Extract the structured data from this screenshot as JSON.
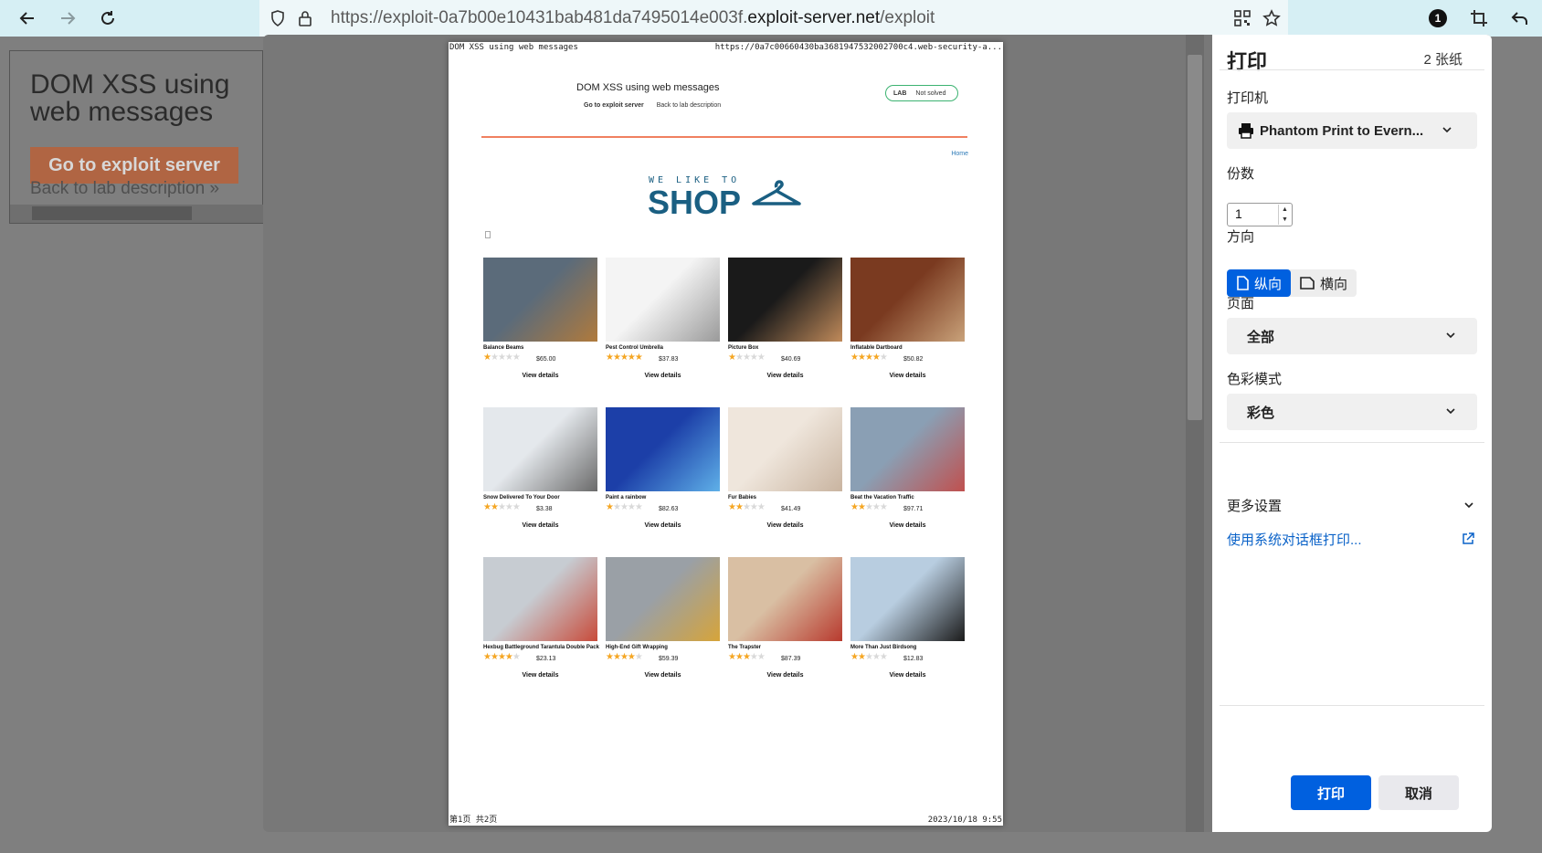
{
  "browser": {
    "url_prefix": "https://exploit-0a7b00e10431bab481da7495014e003f.",
    "url_domain": "exploit-server.net",
    "url_path": "/exploit",
    "badge_count": "1"
  },
  "background_page": {
    "title": "DOM XSS using web messages",
    "button": "Go to exploit server",
    "link": "Back to lab description"
  },
  "preview": {
    "header_left": "DOM XSS using web messages",
    "header_right": "https://0a7c00660430ba3681947532002700c4.web-security-a...",
    "footer_left": "第1页 共2页",
    "footer_right": "2023/10/18 9:55",
    "lab_title": "DOM XSS using web messages",
    "exploit_link": "Go to exploit server",
    "description_link": "Back to lab description",
    "lab_badge": "LAB",
    "lab_status": "Not solved",
    "home_link": "Home",
    "logo_small": "WE LIKE TO",
    "logo_big": "SHOP",
    "view_label": "View details",
    "products": [
      {
        "name": "Balance Beams",
        "price": "$65.00",
        "rating": 1,
        "palette": [
          "#5b6b7a",
          "#b07a3c"
        ]
      },
      {
        "name": "Pest Control Umbrella",
        "price": "$37.83",
        "rating": 5,
        "palette": [
          "#f4f4f4",
          "#9a9a9a"
        ]
      },
      {
        "name": "Picture Box",
        "price": "$40.69",
        "rating": 1,
        "palette": [
          "#1a1a1a",
          "#c08a5a"
        ]
      },
      {
        "name": "Inflatable Dartboard",
        "price": "$50.82",
        "rating": 4,
        "palette": [
          "#7a3a20",
          "#c9a27a"
        ]
      },
      {
        "name": "Snow Delivered To Your Door",
        "price": "$3.38",
        "rating": 2,
        "palette": [
          "#e4e8ec",
          "#6a6a6a"
        ]
      },
      {
        "name": "Paint a rainbow",
        "price": "$82.63",
        "rating": 1,
        "palette": [
          "#1c3fa8",
          "#5fb0e8"
        ]
      },
      {
        "name": "Fur Babies",
        "price": "$41.49",
        "rating": 2,
        "palette": [
          "#efe6dc",
          "#c9b4a0"
        ]
      },
      {
        "name": "Beat the Vacation Traffic",
        "price": "$97.71",
        "rating": 2,
        "palette": [
          "#8a9fb4",
          "#c0504e"
        ]
      },
      {
        "name": "Hexbug Battleground Tarantula Double Pack",
        "price": "$23.13",
        "rating": 4,
        "palette": [
          "#c7ccd2",
          "#c84b3a"
        ]
      },
      {
        "name": "High-End Gift Wrapping",
        "price": "$59.39",
        "rating": 4,
        "palette": [
          "#9aa0a6",
          "#d6a43a"
        ]
      },
      {
        "name": "The Trapster",
        "price": "$87.39",
        "rating": 3,
        "palette": [
          "#d9bfa3",
          "#b83a2e"
        ]
      },
      {
        "name": "More Than Just Birdsong",
        "price": "$12.83",
        "rating": 2,
        "palette": [
          "#b8cde0",
          "#1b1b1b"
        ]
      }
    ]
  },
  "print_panel": {
    "title": "打印",
    "sheets": "2 张纸",
    "printer_label": "打印机",
    "printer_value": "Phantom Print to Evern...",
    "copies_label": "份数",
    "copies_value": "1",
    "orientation_label": "方向",
    "portrait": "纵向",
    "landscape": "横向",
    "pages_label": "页面",
    "pages_value": "全部",
    "color_label": "色彩模式",
    "color_value": "彩色",
    "more_settings": "更多设置",
    "system_dialog": "使用系统对话框打印...",
    "print_button": "打印",
    "cancel_button": "取消"
  }
}
